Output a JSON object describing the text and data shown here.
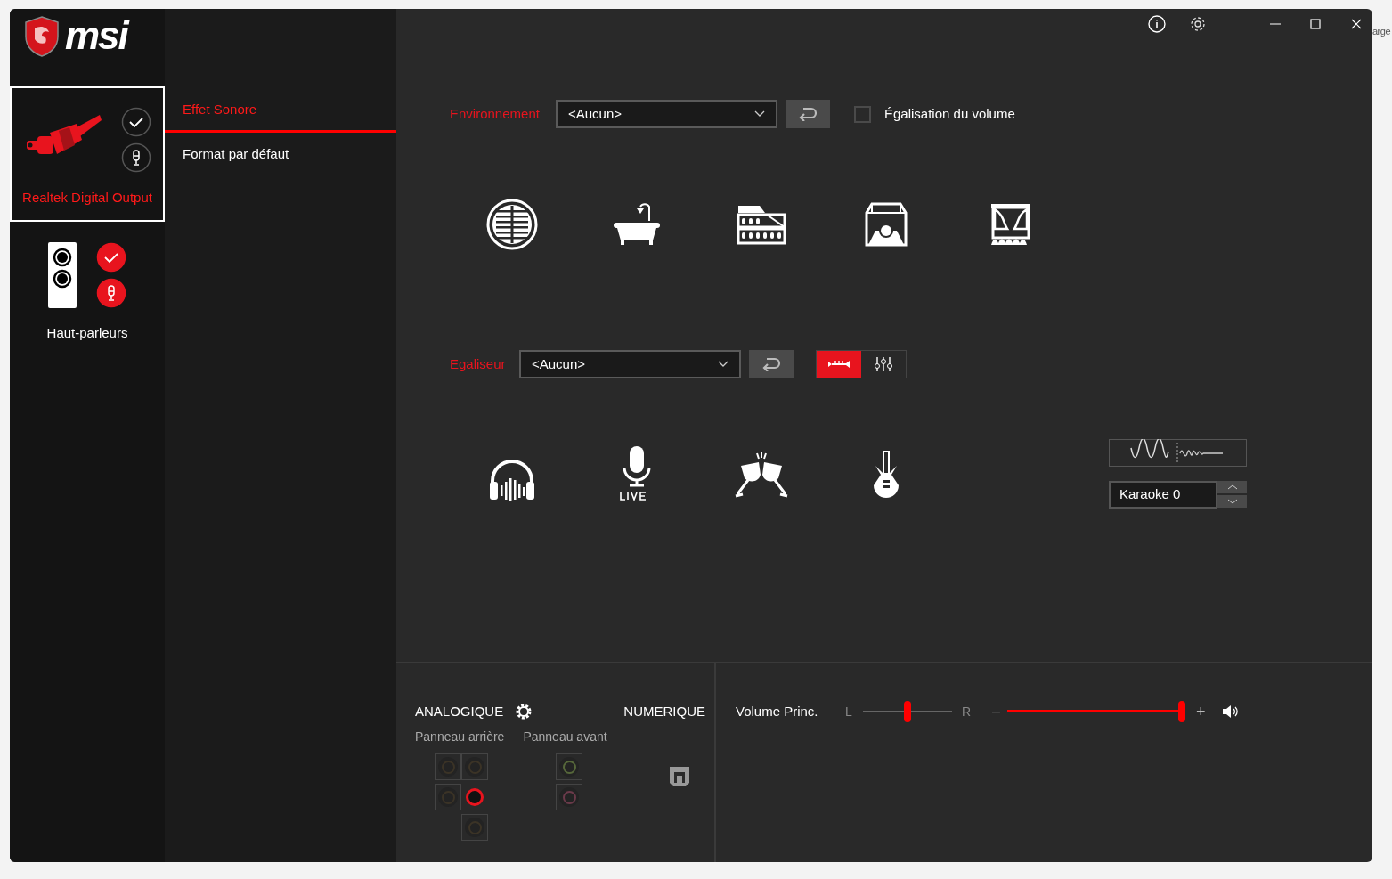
{
  "background": {
    "cut_text": "arge"
  },
  "window": {
    "logo": "msi"
  },
  "devices": [
    {
      "name": "Realtek Digital Output",
      "kind": "digital",
      "selected": true,
      "default": false
    },
    {
      "name": "Haut-parleurs",
      "kind": "speaker",
      "selected": false,
      "default": true
    }
  ],
  "tabs": [
    {
      "label": "Effet Sonore",
      "selected": true
    },
    {
      "label": "Format par défaut",
      "selected": false
    }
  ],
  "environment": {
    "label": "Environnement",
    "value": "<Aucun>",
    "checkbox": {
      "label": "Égalisation du volume",
      "checked": false
    }
  },
  "equalizer": {
    "label": "Egaliseur",
    "value": "<Aucun>",
    "modes": [
      {
        "kind": "presets",
        "selected": true
      },
      {
        "kind": "sliders",
        "selected": false
      }
    ],
    "karaoke": {
      "value": "Karaoke 0"
    }
  },
  "analog": {
    "title": "ANALOGIQUE",
    "rear_label": "Panneau arrière",
    "front_label": "Panneau avant",
    "rear_jacks": [
      {
        "active": false
      },
      {
        "active": false
      },
      {
        "active": false
      },
      {
        "active": true
      },
      {
        "active": false
      }
    ],
    "front_jacks": [
      {
        "color": "#56673a"
      },
      {
        "color": "#6b3a4a"
      }
    ]
  },
  "digital": {
    "title": "NUMERIQUE"
  },
  "volume": {
    "label": "Volume Princ.",
    "left": "L",
    "right": "R",
    "minus": "–",
    "plus": "+",
    "balance": {
      "level": 0.5
    },
    "master": {
      "level": 1.0
    }
  }
}
